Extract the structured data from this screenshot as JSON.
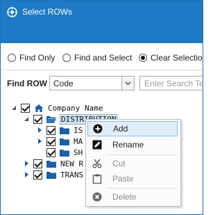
{
  "window": {
    "title": "Select ROWs",
    "accent": "#1e7ac5"
  },
  "mode_options": [
    {
      "label": "Find Only",
      "selected": false
    },
    {
      "label": "Find and Select",
      "selected": false
    },
    {
      "label": "Clear Selection",
      "selected": true
    }
  ],
  "find": {
    "label": "Find ROW",
    "field_value": "Code",
    "search_placeholder": "Enter Search Text"
  },
  "tree": {
    "root": "Company Name",
    "selected_node": "DISTRIBUTION",
    "children_visible": [
      "IS",
      "MA",
      "SH"
    ],
    "siblings_visible": [
      "NEW R",
      "TRANS"
    ]
  },
  "context_menu": {
    "items": [
      {
        "label": "Add",
        "icon": "plus-circle-icon",
        "enabled": true,
        "hover": true
      },
      {
        "label": "Rename",
        "icon": "rename-icon",
        "enabled": true
      },
      {
        "label": "Cut",
        "icon": "scissors-icon",
        "enabled": false
      },
      {
        "label": "Paste",
        "icon": "clipboard-icon",
        "enabled": false
      },
      {
        "label": "Delete",
        "icon": "delete-icon",
        "enabled": false
      }
    ]
  }
}
